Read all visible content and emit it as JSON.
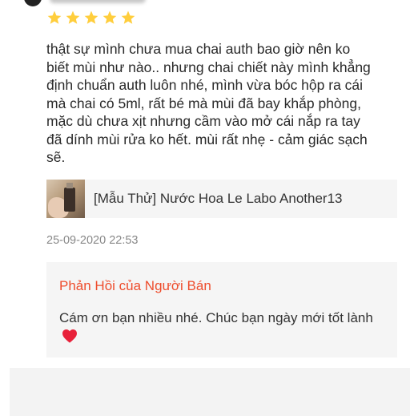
{
  "review": {
    "rating": 5,
    "rating_max": 5,
    "star_color": "#ffce3d",
    "text": "thật sự mình chưa mua chai auth bao giờ nên ko\nbiết mùi như nào.. nhưng chai chiết này mình khẳng\nđịnh chuẩn auth luôn nhé, mình vừa bóc hộp ra cái\nmà chai có 5ml, rất bé mà mùi đã bay khắp phòng,\nmặc dù chưa xịt nhưng cầm vào mở cái nắp ra tay\nđã dính mùi rửa ko hết. mùi rất nhẹ - cảm giác sạch\nsẽ.",
    "product_name": "[Mẫu Thử] Nước Hoa Le Labo Another13",
    "date": "25-09-2020 22:53"
  },
  "seller_reply": {
    "title": "Phản Hồi của Người Bán",
    "title_color": "#ee4d2d",
    "text": "Cám ơn bạn nhiều nhé. Chúc bạn ngày mới tốt lành",
    "emoji_icon": "red-heart-icon"
  }
}
